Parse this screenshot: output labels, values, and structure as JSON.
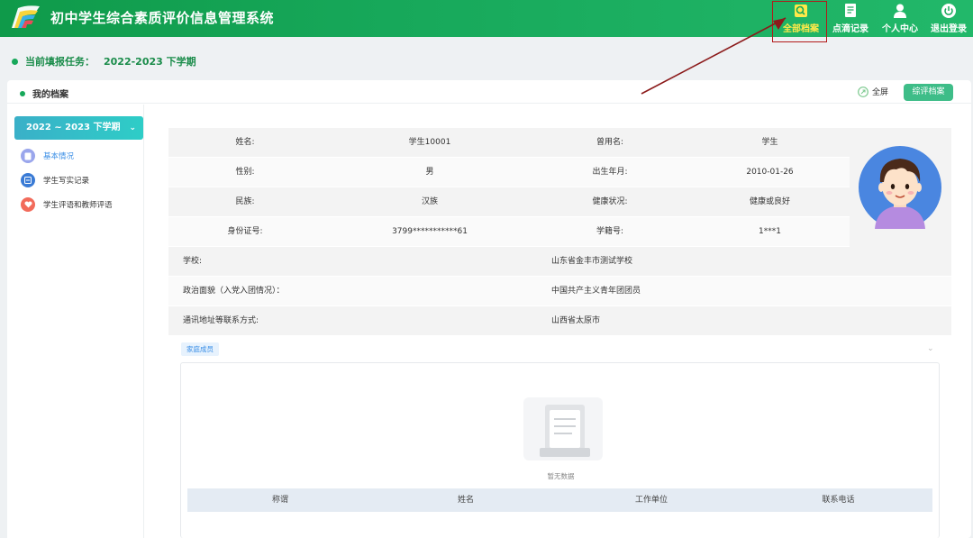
{
  "app": {
    "title": "初中学生综合素质评价信息管理系统"
  },
  "nav": [
    {
      "label": "全部档案",
      "icon": "archive-search-icon",
      "active": true
    },
    {
      "label": "点滴记录",
      "icon": "record-book-icon",
      "active": false
    },
    {
      "label": "个人中心",
      "icon": "user-icon",
      "active": false
    },
    {
      "label": "退出登录",
      "icon": "power-icon",
      "active": false
    }
  ],
  "task": {
    "label": "当前填报任务：",
    "value": "2022-2023 下学期"
  },
  "card": {
    "title": "我的档案",
    "fullscreen_label": "全屏",
    "review_button": "综评档案"
  },
  "sidebar": {
    "term": "2022 ~ 2023 下学期",
    "items": [
      {
        "label": "基本情况",
        "icon": "basic-info-icon",
        "color": "#7b8ee6",
        "active": true
      },
      {
        "label": "学生写实记录",
        "icon": "record-icon",
        "color": "#3a7bd5",
        "active": false
      },
      {
        "label": "学生评语和教师评语",
        "icon": "heart-icon",
        "color": "#f26b5b",
        "active": false
      }
    ]
  },
  "student": {
    "rows4": [
      {
        "l1": "姓名:",
        "v1": "学生10001",
        "l2": "曾用名:",
        "v2": "学生"
      },
      {
        "l1": "性别:",
        "v1": "男",
        "l2": "出生年月:",
        "v2": "2010-01-26"
      },
      {
        "l1": "民族:",
        "v1": "汉族",
        "l2": "健康状况:",
        "v2": "健康或良好"
      },
      {
        "l1": "身份证号:",
        "v1": "3799***********61",
        "l2": "学籍号:",
        "v2": "1***1"
      }
    ],
    "rows2": [
      {
        "label": "学校:",
        "value": "山东省金丰市测试学校"
      },
      {
        "label": "政治面貌（入党入团情况）：",
        "value": "中国共产主义青年团团员"
      },
      {
        "label": "通讯地址等联系方式:",
        "value": "山西省太原市"
      }
    ]
  },
  "family": {
    "tag": "家庭成员",
    "empty_text": "暂无数据",
    "columns": [
      "称谓",
      "姓名",
      "工作单位",
      "联系电话"
    ]
  },
  "colors": {
    "brand": "#17a85a",
    "accent_blue": "#3a8ee6",
    "highlight": "#b21a1a",
    "active_nav": "#ffe94a"
  }
}
